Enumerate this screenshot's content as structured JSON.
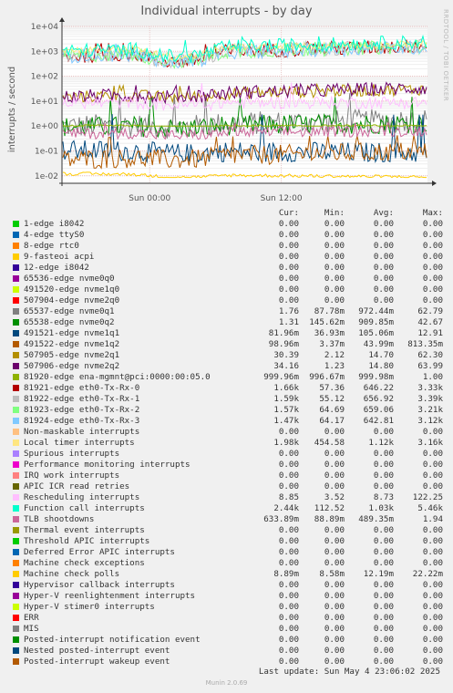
{
  "title": "Individual interrupts - by day",
  "side_credit": "RRDTOOL / TOBI OETIKER",
  "last_update": "Last update: Sun May  4 23:06:02 2025",
  "munin_version": "Munin 2.0.69",
  "columns": {
    "cur": "Cur:",
    "min": "Min:",
    "avg": "Avg:",
    "max": "Max:"
  },
  "chart_data": {
    "type": "line",
    "title": "Individual interrupts - by day",
    "ylabel": "interrupts / second",
    "yscale": "log",
    "ylim": [
      0.005,
      10000
    ],
    "yticks": [
      {
        "label": "1e-02",
        "value": 0.01
      },
      {
        "label": "1e-01",
        "value": 0.1
      },
      {
        "label": "1e+00",
        "value": 1
      },
      {
        "label": "1e+01",
        "value": 10
      },
      {
        "label": "1e+02",
        "value": 100
      },
      {
        "label": "1e+03",
        "value": 1000
      },
      {
        "label": "1e+04",
        "value": 10000
      }
    ],
    "xticks": [
      {
        "label": "Sun 00:00",
        "frac": 0.24
      },
      {
        "label": "Sun 12:00",
        "frac": 0.6
      }
    ],
    "grid": true,
    "series": [
      {
        "name": "1-edge      i8042",
        "color": "#00cc00",
        "cur": "0.00",
        "min": "0.00",
        "avg": "0.00",
        "max": "0.00"
      },
      {
        "name": "4-edge      ttyS0",
        "color": "#0066b3",
        "cur": "0.00",
        "min": "0.00",
        "avg": "0.00",
        "max": "0.00"
      },
      {
        "name": "8-edge      rtc0",
        "color": "#ff8000",
        "cur": "0.00",
        "min": "0.00",
        "avg": "0.00",
        "max": "0.00"
      },
      {
        "name": "9-fasteoi   acpi",
        "color": "#ffcc00",
        "cur": "0.00",
        "min": "0.00",
        "avg": "0.00",
        "max": "0.00"
      },
      {
        "name": "12-edge      i8042",
        "color": "#330099",
        "cur": "0.00",
        "min": "0.00",
        "avg": "0.00",
        "max": "0.00"
      },
      {
        "name": "65536-edge      nvme0q0",
        "color": "#990099",
        "cur": "0.00",
        "min": "0.00",
        "avg": "0.00",
        "max": "0.00"
      },
      {
        "name": "491520-edge      nvme1q0",
        "color": "#ccff00",
        "cur": "0.00",
        "min": "0.00",
        "avg": "0.00",
        "max": "0.00"
      },
      {
        "name": "507904-edge      nvme2q0",
        "color": "#ff0000",
        "cur": "0.00",
        "min": "0.00",
        "avg": "0.00",
        "max": "0.00"
      },
      {
        "name": "65537-edge      nvme0q1",
        "color": "#808080",
        "cur": "1.76",
        "min": "87.78m",
        "avg": "972.44m",
        "max": "62.79"
      },
      {
        "name": "65538-edge      nvme0q2",
        "color": "#008f00",
        "cur": "1.31",
        "min": "145.62m",
        "avg": "909.85m",
        "max": "42.67"
      },
      {
        "name": "491521-edge      nvme1q1",
        "color": "#00487d",
        "cur": "81.96m",
        "min": "36.93m",
        "avg": "105.06m",
        "max": "12.91"
      },
      {
        "name": "491522-edge      nvme1q2",
        "color": "#b35a00",
        "cur": "98.96m",
        "min": "3.37m",
        "avg": "43.99m",
        "max": "813.35m"
      },
      {
        "name": "507905-edge      nvme2q1",
        "color": "#b38f00",
        "cur": "30.39",
        "min": "2.12",
        "avg": "14.70",
        "max": "62.30"
      },
      {
        "name": "507906-edge      nvme2q2",
        "color": "#6b006b",
        "cur": "34.16",
        "min": "1.23",
        "avg": "14.80",
        "max": "63.99"
      },
      {
        "name": "81920-edge      ena-mgmnt@pci:0000:00:05.0",
        "color": "#8fb300",
        "cur": "999.96m",
        "min": "996.67m",
        "avg": "999.98m",
        "max": "1.00"
      },
      {
        "name": "81921-edge      eth0-Tx-Rx-0",
        "color": "#b30000",
        "cur": "1.66k",
        "min": "57.36",
        "avg": "646.22",
        "max": "3.33k"
      },
      {
        "name": "81922-edge      eth0-Tx-Rx-1",
        "color": "#bebebe",
        "cur": "1.59k",
        "min": "55.12",
        "avg": "656.92",
        "max": "3.39k"
      },
      {
        "name": "81923-edge      eth0-Tx-Rx-2",
        "color": "#80ff80",
        "cur": "1.57k",
        "min": "64.69",
        "avg": "659.06",
        "max": "3.21k"
      },
      {
        "name": "81924-edge      eth0-Tx-Rx-3",
        "color": "#80c9ff",
        "cur": "1.47k",
        "min": "64.17",
        "avg": "642.81",
        "max": "3.12k"
      },
      {
        "name": "Non-maskable interrupts",
        "color": "#ffc080",
        "cur": "0.00",
        "min": "0.00",
        "avg": "0.00",
        "max": "0.00"
      },
      {
        "name": "Local timer interrupts",
        "color": "#ffe680",
        "cur": "1.98k",
        "min": "454.58",
        "avg": "1.12k",
        "max": "3.16k"
      },
      {
        "name": "Spurious interrupts",
        "color": "#aa80ff",
        "cur": "0.00",
        "min": "0.00",
        "avg": "0.00",
        "max": "0.00"
      },
      {
        "name": "Performance monitoring interrupts",
        "color": "#ee00cc",
        "cur": "0.00",
        "min": "0.00",
        "avg": "0.00",
        "max": "0.00"
      },
      {
        "name": "IRQ work interrupts",
        "color": "#ff8080",
        "cur": "0.00",
        "min": "0.00",
        "avg": "0.00",
        "max": "0.00"
      },
      {
        "name": "APIC ICR read retries",
        "color": "#666600",
        "cur": "0.00",
        "min": "0.00",
        "avg": "0.00",
        "max": "0.00"
      },
      {
        "name": "Rescheduling interrupts",
        "color": "#ffbfff",
        "cur": "8.85",
        "min": "3.52",
        "avg": "8.73",
        "max": "122.25"
      },
      {
        "name": "Function call interrupts",
        "color": "#00ffcc",
        "cur": "2.44k",
        "min": "112.52",
        "avg": "1.03k",
        "max": "5.46k"
      },
      {
        "name": "TLB shootdowns",
        "color": "#cc6699",
        "cur": "633.89m",
        "min": "88.89m",
        "avg": "489.35m",
        "max": "1.94"
      },
      {
        "name": "Thermal event interrupts",
        "color": "#999900",
        "cur": "0.00",
        "min": "0.00",
        "avg": "0.00",
        "max": "0.00"
      },
      {
        "name": "Threshold APIC interrupts",
        "color": "#00cc00",
        "cur": "0.00",
        "min": "0.00",
        "avg": "0.00",
        "max": "0.00"
      },
      {
        "name": "Deferred Error APIC interrupts",
        "color": "#0066b3",
        "cur": "0.00",
        "min": "0.00",
        "avg": "0.00",
        "max": "0.00"
      },
      {
        "name": "Machine check exceptions",
        "color": "#ff8000",
        "cur": "0.00",
        "min": "0.00",
        "avg": "0.00",
        "max": "0.00"
      },
      {
        "name": "Machine check polls",
        "color": "#ffcc00",
        "cur": "8.89m",
        "min": "8.58m",
        "avg": "12.19m",
        "max": "22.22m"
      },
      {
        "name": "Hypervisor callback interrupts",
        "color": "#330099",
        "cur": "0.00",
        "min": "0.00",
        "avg": "0.00",
        "max": "0.00"
      },
      {
        "name": "Hyper-V reenlightenment interrupts",
        "color": "#990099",
        "cur": "0.00",
        "min": "0.00",
        "avg": "0.00",
        "max": "0.00"
      },
      {
        "name": "Hyper-V stimer0 interrupts",
        "color": "#ccff00",
        "cur": "0.00",
        "min": "0.00",
        "avg": "0.00",
        "max": "0.00"
      },
      {
        "name": "ERR",
        "color": "#ff0000",
        "cur": "0.00",
        "min": "0.00",
        "avg": "0.00",
        "max": "0.00"
      },
      {
        "name": "MIS",
        "color": "#808080",
        "cur": "0.00",
        "min": "0.00",
        "avg": "0.00",
        "max": "0.00"
      },
      {
        "name": "Posted-interrupt notification event",
        "color": "#008f00",
        "cur": "0.00",
        "min": "0.00",
        "avg": "0.00",
        "max": "0.00"
      },
      {
        "name": "Nested posted-interrupt event",
        "color": "#00487d",
        "cur": "0.00",
        "min": "0.00",
        "avg": "0.00",
        "max": "0.00"
      },
      {
        "name": "Posted-interrupt wakeup event",
        "color": "#b35a00",
        "cur": "0.00",
        "min": "0.00",
        "avg": "0.00",
        "max": "0.00"
      }
    ]
  }
}
